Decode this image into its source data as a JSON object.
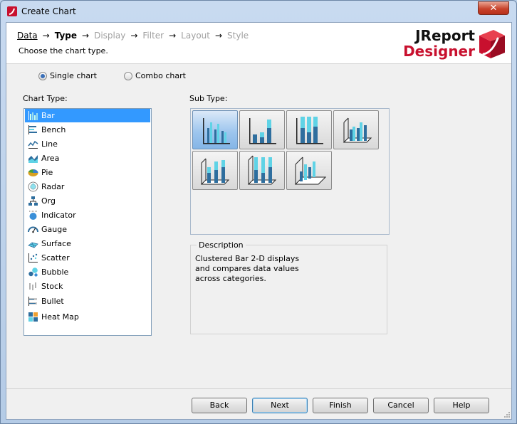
{
  "window": {
    "title": "Create Chart",
    "close_label": "✕"
  },
  "wizard": {
    "steps": [
      {
        "label": "Data",
        "state": "done"
      },
      {
        "label": "Type",
        "state": "current"
      },
      {
        "label": "Display",
        "state": "pending"
      },
      {
        "label": "Filter",
        "state": "pending"
      },
      {
        "label": "Layout",
        "state": "pending"
      },
      {
        "label": "Style",
        "state": "pending"
      }
    ],
    "arrow": "→",
    "subtitle": "Choose the chart type."
  },
  "logo": {
    "line1": "JReport",
    "line2": "Designer",
    "accent_color": "#c8102e"
  },
  "mode": {
    "options": [
      "Single chart",
      "Combo chart"
    ],
    "selected": "Single chart"
  },
  "chart_type": {
    "label": "Chart Type:",
    "items": [
      {
        "label": "Bar",
        "icon": "bar-chart-icon"
      },
      {
        "label": "Bench",
        "icon": "bench-chart-icon"
      },
      {
        "label": "Line",
        "icon": "line-chart-icon"
      },
      {
        "label": "Area",
        "icon": "area-chart-icon"
      },
      {
        "label": "Pie",
        "icon": "pie-chart-icon"
      },
      {
        "label": "Radar",
        "icon": "radar-chart-icon"
      },
      {
        "label": "Org",
        "icon": "org-chart-icon"
      },
      {
        "label": "Indicator",
        "icon": "indicator-chart-icon"
      },
      {
        "label": "Gauge",
        "icon": "gauge-chart-icon"
      },
      {
        "label": "Surface",
        "icon": "surface-chart-icon"
      },
      {
        "label": "Scatter",
        "icon": "scatter-chart-icon"
      },
      {
        "label": "Bubble",
        "icon": "bubble-chart-icon"
      },
      {
        "label": "Stock",
        "icon": "stock-chart-icon"
      },
      {
        "label": "Bullet",
        "icon": "bullet-chart-icon"
      },
      {
        "label": "Heat Map",
        "icon": "heat-map-icon"
      }
    ],
    "selected": "Bar"
  },
  "sub_type": {
    "label": "Sub Type:",
    "tiles": [
      {
        "icon": "clustered-bar-2d-icon",
        "selected": true
      },
      {
        "icon": "stacked-bar-2d-icon",
        "selected": false
      },
      {
        "icon": "percent-stacked-bar-2d-icon",
        "selected": false
      },
      {
        "icon": "clustered-bar-3d-icon",
        "selected": false
      },
      {
        "icon": "stacked-bar-3d-icon",
        "selected": false
      },
      {
        "icon": "percent-stacked-bar-3d-icon",
        "selected": false
      },
      {
        "icon": "bar-3d-depth-icon",
        "selected": false
      }
    ]
  },
  "description": {
    "label": "Description",
    "text": "Clustered Bar 2-D displays and compares data values across categories."
  },
  "buttons": {
    "back": "Back",
    "next": "Next",
    "finish": "Finish",
    "cancel": "Cancel",
    "help": "Help"
  },
  "colors": {
    "selection": "#3399ff",
    "bar_light": "#5fd3e6",
    "bar_dark": "#2e6e9e"
  }
}
